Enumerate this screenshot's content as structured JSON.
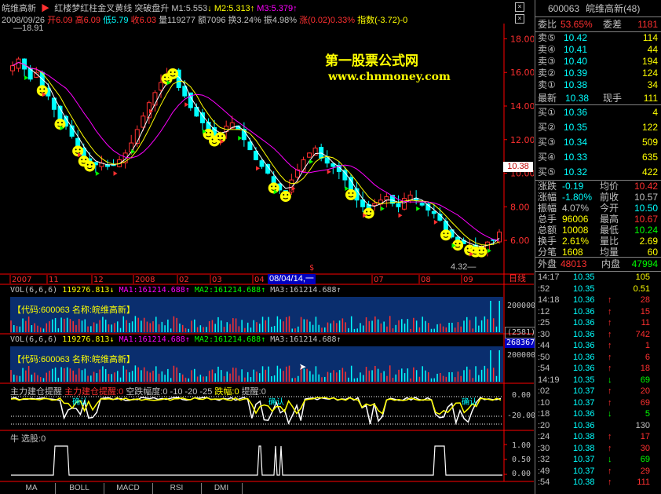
{
  "main_header": {
    "stock_name": "皖维高新",
    "formula_name": "红楼梦红柱金叉黄线",
    "signal": "突破盘升",
    "m1": "M1:5.553",
    "m2": "M2:5.313",
    "m3": "M3:5.379",
    "date": "2008/09/26",
    "open": "开6.09",
    "high": "高6.09",
    "low": "低5.79",
    "close": "收6.03",
    "volume": "量119277",
    "amount": "额7096",
    "turnover": "换3.24%",
    "amplitude": "振4.98%",
    "change": "涨(0.02)0.33%",
    "index": "指数(-3.72)-0",
    "max_label": "18.91",
    "min_label": "4.32",
    "last_price_tag": "10.38"
  },
  "watermark": {
    "line1": "第一股票公式网",
    "line2": "www.chnmoney.com"
  },
  "y_axis_main": [
    "18.00",
    "16.00",
    "14.00",
    "12.00",
    "10.00",
    "8.00",
    "6.00"
  ],
  "time_axis": {
    "labels": [
      "2007",
      "11",
      "12",
      "2008",
      "02",
      "03",
      "04",
      "06",
      "07",
      "08",
      "09"
    ],
    "cursor_date": "08/04/14,一",
    "right_label": "日线"
  },
  "vol_panel1": {
    "title": "VOL(6,6,6)",
    "value": "119276.813",
    "ma1": "MA1:161214.688",
    "ma2": "MA2:161214.688",
    "ma3": "MA3:161214.688",
    "info": "【代码:600063 名称:皖维高新】",
    "axis_label": "200000"
  },
  "vol_panel2": {
    "title": "VOL(6,6,6)",
    "value": "119276.813",
    "ma1": "MA1:161214.688",
    "ma2": "MA2:161214.688",
    "ma3": "MA3:161214.688",
    "info": "【代码:600063 名称:皖维高新】",
    "axis_label": "200000",
    "tag1": "(2581)",
    "tag2": "268367"
  },
  "zl_panel": {
    "title": "主力建仓提醒",
    "title2": "主力建仓提醒:0",
    "params": "空跌幅度:0 -10 -20 -25",
    "drop": "跌幅:0",
    "remind": "提醒:0",
    "axis": [
      "0.00",
      "-20.00"
    ],
    "marker": "确认"
  },
  "niu_panel": {
    "title": "牛 选股:0",
    "axis": [
      "1.00",
      "0.50",
      "0.00"
    ]
  },
  "bottom_tabs": [
    "MA",
    "BOLL",
    "MACD",
    "RSI",
    "DMI"
  ],
  "quote": {
    "code": "600063",
    "name": "皖维高新(48)",
    "weibi_label": "委比",
    "weibi_value": "53.65%",
    "weicha_label": "委差",
    "weicha_value": "1181",
    "sells": [
      {
        "label": "卖⑤",
        "price": "10.42",
        "vol": "114"
      },
      {
        "label": "卖④",
        "price": "10.41",
        "vol": "44"
      },
      {
        "label": "卖③",
        "price": "10.40",
        "vol": "194"
      },
      {
        "label": "卖②",
        "price": "10.39",
        "vol": "124"
      },
      {
        "label": "卖①",
        "price": "10.38",
        "vol": "34"
      }
    ],
    "latest_label": "最新",
    "latest_value": "10.38",
    "xianshou_label": "现手",
    "xianshou_value": "111",
    "buys": [
      {
        "label": "买①",
        "price": "10.36",
        "vol": "4"
      },
      {
        "label": "买②",
        "price": "10.35",
        "vol": "122"
      },
      {
        "label": "买③",
        "price": "10.34",
        "vol": "509"
      },
      {
        "label": "买④",
        "price": "10.33",
        "vol": "635"
      },
      {
        "label": "买⑤",
        "price": "10.32",
        "vol": "422"
      }
    ],
    "stats": [
      {
        "l1": "涨跌",
        "v1": "-0.19",
        "l2": "均价",
        "v2": "10.42",
        "c1": "#00ffff",
        "c2": "#ff3030"
      },
      {
        "l1": "涨幅",
        "v1": "-1.80%",
        "l2": "前收",
        "v2": "10.57",
        "c1": "#00ffff",
        "c2": "#c0c0c0"
      },
      {
        "l1": "振幅",
        "v1": "4.07%",
        "l2": "今开",
        "v2": "10.50",
        "c1": "#c0c0c0",
        "c2": "#00ffff"
      },
      {
        "l1": "总手",
        "v1": "96006",
        "l2": "最高",
        "v2": "10.67",
        "c1": "#ffff00",
        "c2": "#ff3030"
      },
      {
        "l1": "总额",
        "v1": "10008",
        "l2": "最低",
        "v2": "10.24",
        "c1": "#ffff00",
        "c2": "#00ff00"
      },
      {
        "l1": "换手",
        "v1": "2.61%",
        "l2": "量比",
        "v2": "2.69",
        "c1": "#ffff00",
        "c2": "#ffff00"
      },
      {
        "l1": "分笔",
        "v1": "1608",
        "l2": "均量",
        "v2": "60",
        "c1": "#ffff00",
        "c2": "#ffff00"
      }
    ],
    "waipan_label": "外盘",
    "waipan_value": "48013",
    "neipan_label": "内盘",
    "neipan_value": "47994",
    "ticks": [
      {
        "time": "14:17",
        "price": "10.35",
        "arrow": "",
        "vol": "105",
        "vc": "#ffff00"
      },
      {
        "time": ":52",
        "price": "10.35",
        "arrow": "",
        "vol": "0.51",
        "vc": "#ffff00"
      },
      {
        "time": "14:18",
        "price": "10.36",
        "arrow": "↑",
        "vol": "28",
        "vc": "#ff3030"
      },
      {
        "time": ":12",
        "price": "10.36",
        "arrow": "↑",
        "vol": "15",
        "vc": "#ff3030"
      },
      {
        "time": ":25",
        "price": "10.36",
        "arrow": "↑",
        "vol": "11",
        "vc": "#ff3030"
      },
      {
        "time": ":30",
        "price": "10.36",
        "arrow": "↑",
        "vol": "742",
        "vc": "#ff3030"
      },
      {
        "time": ":44",
        "price": "10.36",
        "arrow": "↑",
        "vol": "1",
        "vc": "#ff3030"
      },
      {
        "time": ":50",
        "price": "10.36",
        "arrow": "↑",
        "vol": "6",
        "vc": "#ff3030"
      },
      {
        "time": ":54",
        "price": "10.36",
        "arrow": "↑",
        "vol": "18",
        "vc": "#ff3030"
      },
      {
        "time": "14:19",
        "price": "10.35",
        "arrow": "↓",
        "vol": "69",
        "vc": "#00ff00"
      },
      {
        "time": ":02",
        "price": "10.37",
        "arrow": "↑",
        "vol": "20",
        "vc": "#ff3030"
      },
      {
        "time": ":10",
        "price": "10.37",
        "arrow": "↑",
        "vol": "69",
        "vc": "#ff3030"
      },
      {
        "time": ":18",
        "price": "10.36",
        "arrow": "↓",
        "vol": "5",
        "vc": "#00ff00"
      },
      {
        "time": ":20",
        "price": "10.36",
        "arrow": "",
        "vol": "130",
        "vc": "#c0c0c0"
      },
      {
        "time": ":24",
        "price": "10.38",
        "arrow": "↑",
        "vol": "17",
        "vc": "#ff3030"
      },
      {
        "time": ":30",
        "price": "10.38",
        "arrow": "↑",
        "vol": "30",
        "vc": "#ff3030"
      },
      {
        "time": ":32",
        "price": "10.37",
        "arrow": "↓",
        "vol": "69",
        "vc": "#00ff00"
      },
      {
        "time": ":49",
        "price": "10.37",
        "arrow": "↑",
        "vol": "29",
        "vc": "#ff3030"
      },
      {
        "time": ":54",
        "price": "10.38",
        "arrow": "↑",
        "vol": "111",
        "vc": "#ff3030"
      }
    ]
  },
  "chart_data": {
    "type": "candlestick",
    "y_range": [
      4.32,
      18.91
    ],
    "closes": [
      16.4,
      16.8,
      16.2,
      15.6,
      16.0,
      15.2,
      14.6,
      13.8,
      13.2,
      12.8,
      12.2,
      11.6,
      11.0,
      10.7,
      10.5,
      10.6,
      10.4,
      10.5,
      10.8,
      11.2,
      11.8,
      12.6,
      13.4,
      14.2,
      14.8,
      15.4,
      15.9,
      16.2,
      15.1,
      14.6,
      13.9,
      13.4,
      13.0,
      12.6,
      12.2,
      12.4,
      12.8,
      13.0,
      12.6,
      12.0,
      11.4,
      10.8,
      10.4,
      10.0,
      9.4,
      9.0,
      8.9,
      9.6,
      10.2,
      10.8,
      11.2,
      11.5,
      10.9,
      10.6,
      10.4,
      10.1,
      9.6,
      9.0,
      8.4,
      8.0,
      7.9,
      8.2,
      8.4,
      8.6,
      8.2,
      8.0,
      8.5,
      8.7,
      8.4,
      8.1,
      7.8,
      7.6,
      7.2,
      6.6,
      6.2,
      6.0,
      5.8,
      5.7,
      5.6,
      5.6,
      5.9,
      6.0,
      6.5
    ]
  }
}
